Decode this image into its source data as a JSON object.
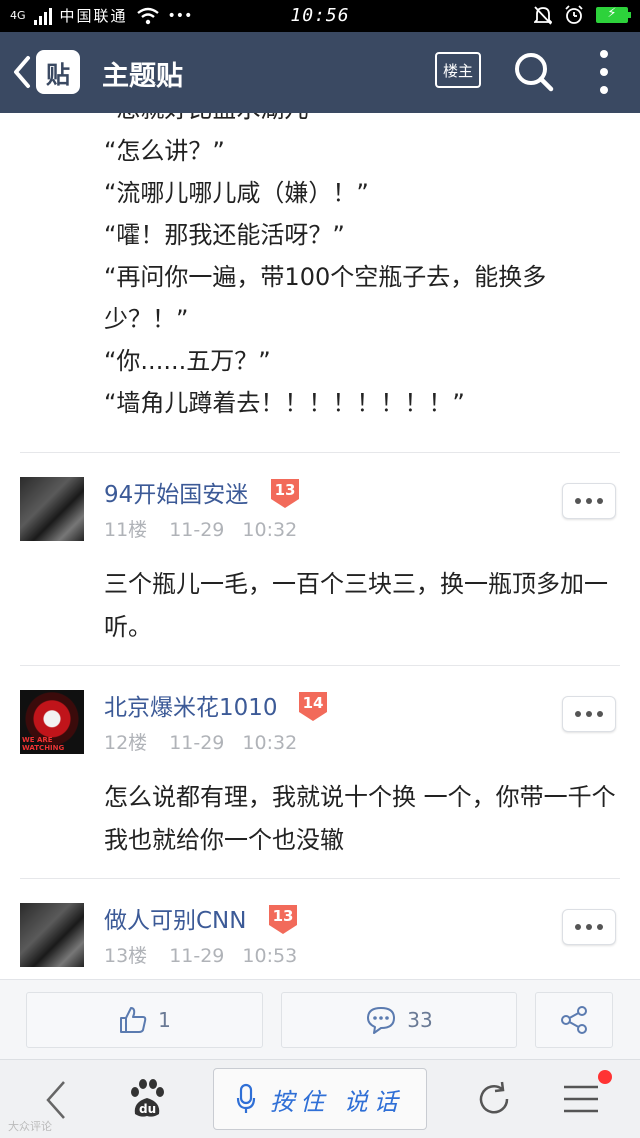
{
  "status_bar": {
    "carrier": "中国联通",
    "network": "4G",
    "time": "10:56",
    "more": "•••"
  },
  "header": {
    "logo_text": "贴",
    "title": "主题贴",
    "louzhu_label": "楼主"
  },
  "first_post": {
    "partial_line": "“想就好比盐水湖儿”",
    "lines": [
      "“怎么讲？”",
      "“流哪儿哪儿咸（嫌）！”",
      "“嚯！那我还能活呀？”",
      "“再问你一遍，带100个空瓶子去，能换多少？！”",
      "“你......五万？”",
      "“墙角儿蹲着去！！！！！！！！”"
    ]
  },
  "replies": [
    {
      "username": "94开始国安迷",
      "level": "13",
      "floor": "11楼",
      "time": "11-29 10:32",
      "text": "三个瓶儿一毛，一百个三块三，换一瓶顶多加一听。"
    },
    {
      "username": "北京爆米花1010",
      "level": "14",
      "floor": "12楼",
      "time": "11-29 10:32",
      "text": "怎么说都有理，我就说十个换 一个，你带一千个我也就给你一个也没辙",
      "avatar_caption": "WE ARE WATCHING"
    },
    {
      "username": "做人可别CNN",
      "level": "13",
      "floor": "13楼",
      "time": "11-29 10:53",
      "text": ""
    }
  ],
  "action_bar": {
    "like_count": "1",
    "comment_count": "33"
  },
  "bottom_nav": {
    "voice_label": "按住 说话",
    "baidu_label": "du"
  },
  "watermark": "大众评论",
  "colors": {
    "header_bg": "#3a4962",
    "username": "#3c5a97",
    "level_badge": "#f26a5a",
    "voice_text": "#2f6fd6",
    "notify_dot": "#ff3333"
  }
}
